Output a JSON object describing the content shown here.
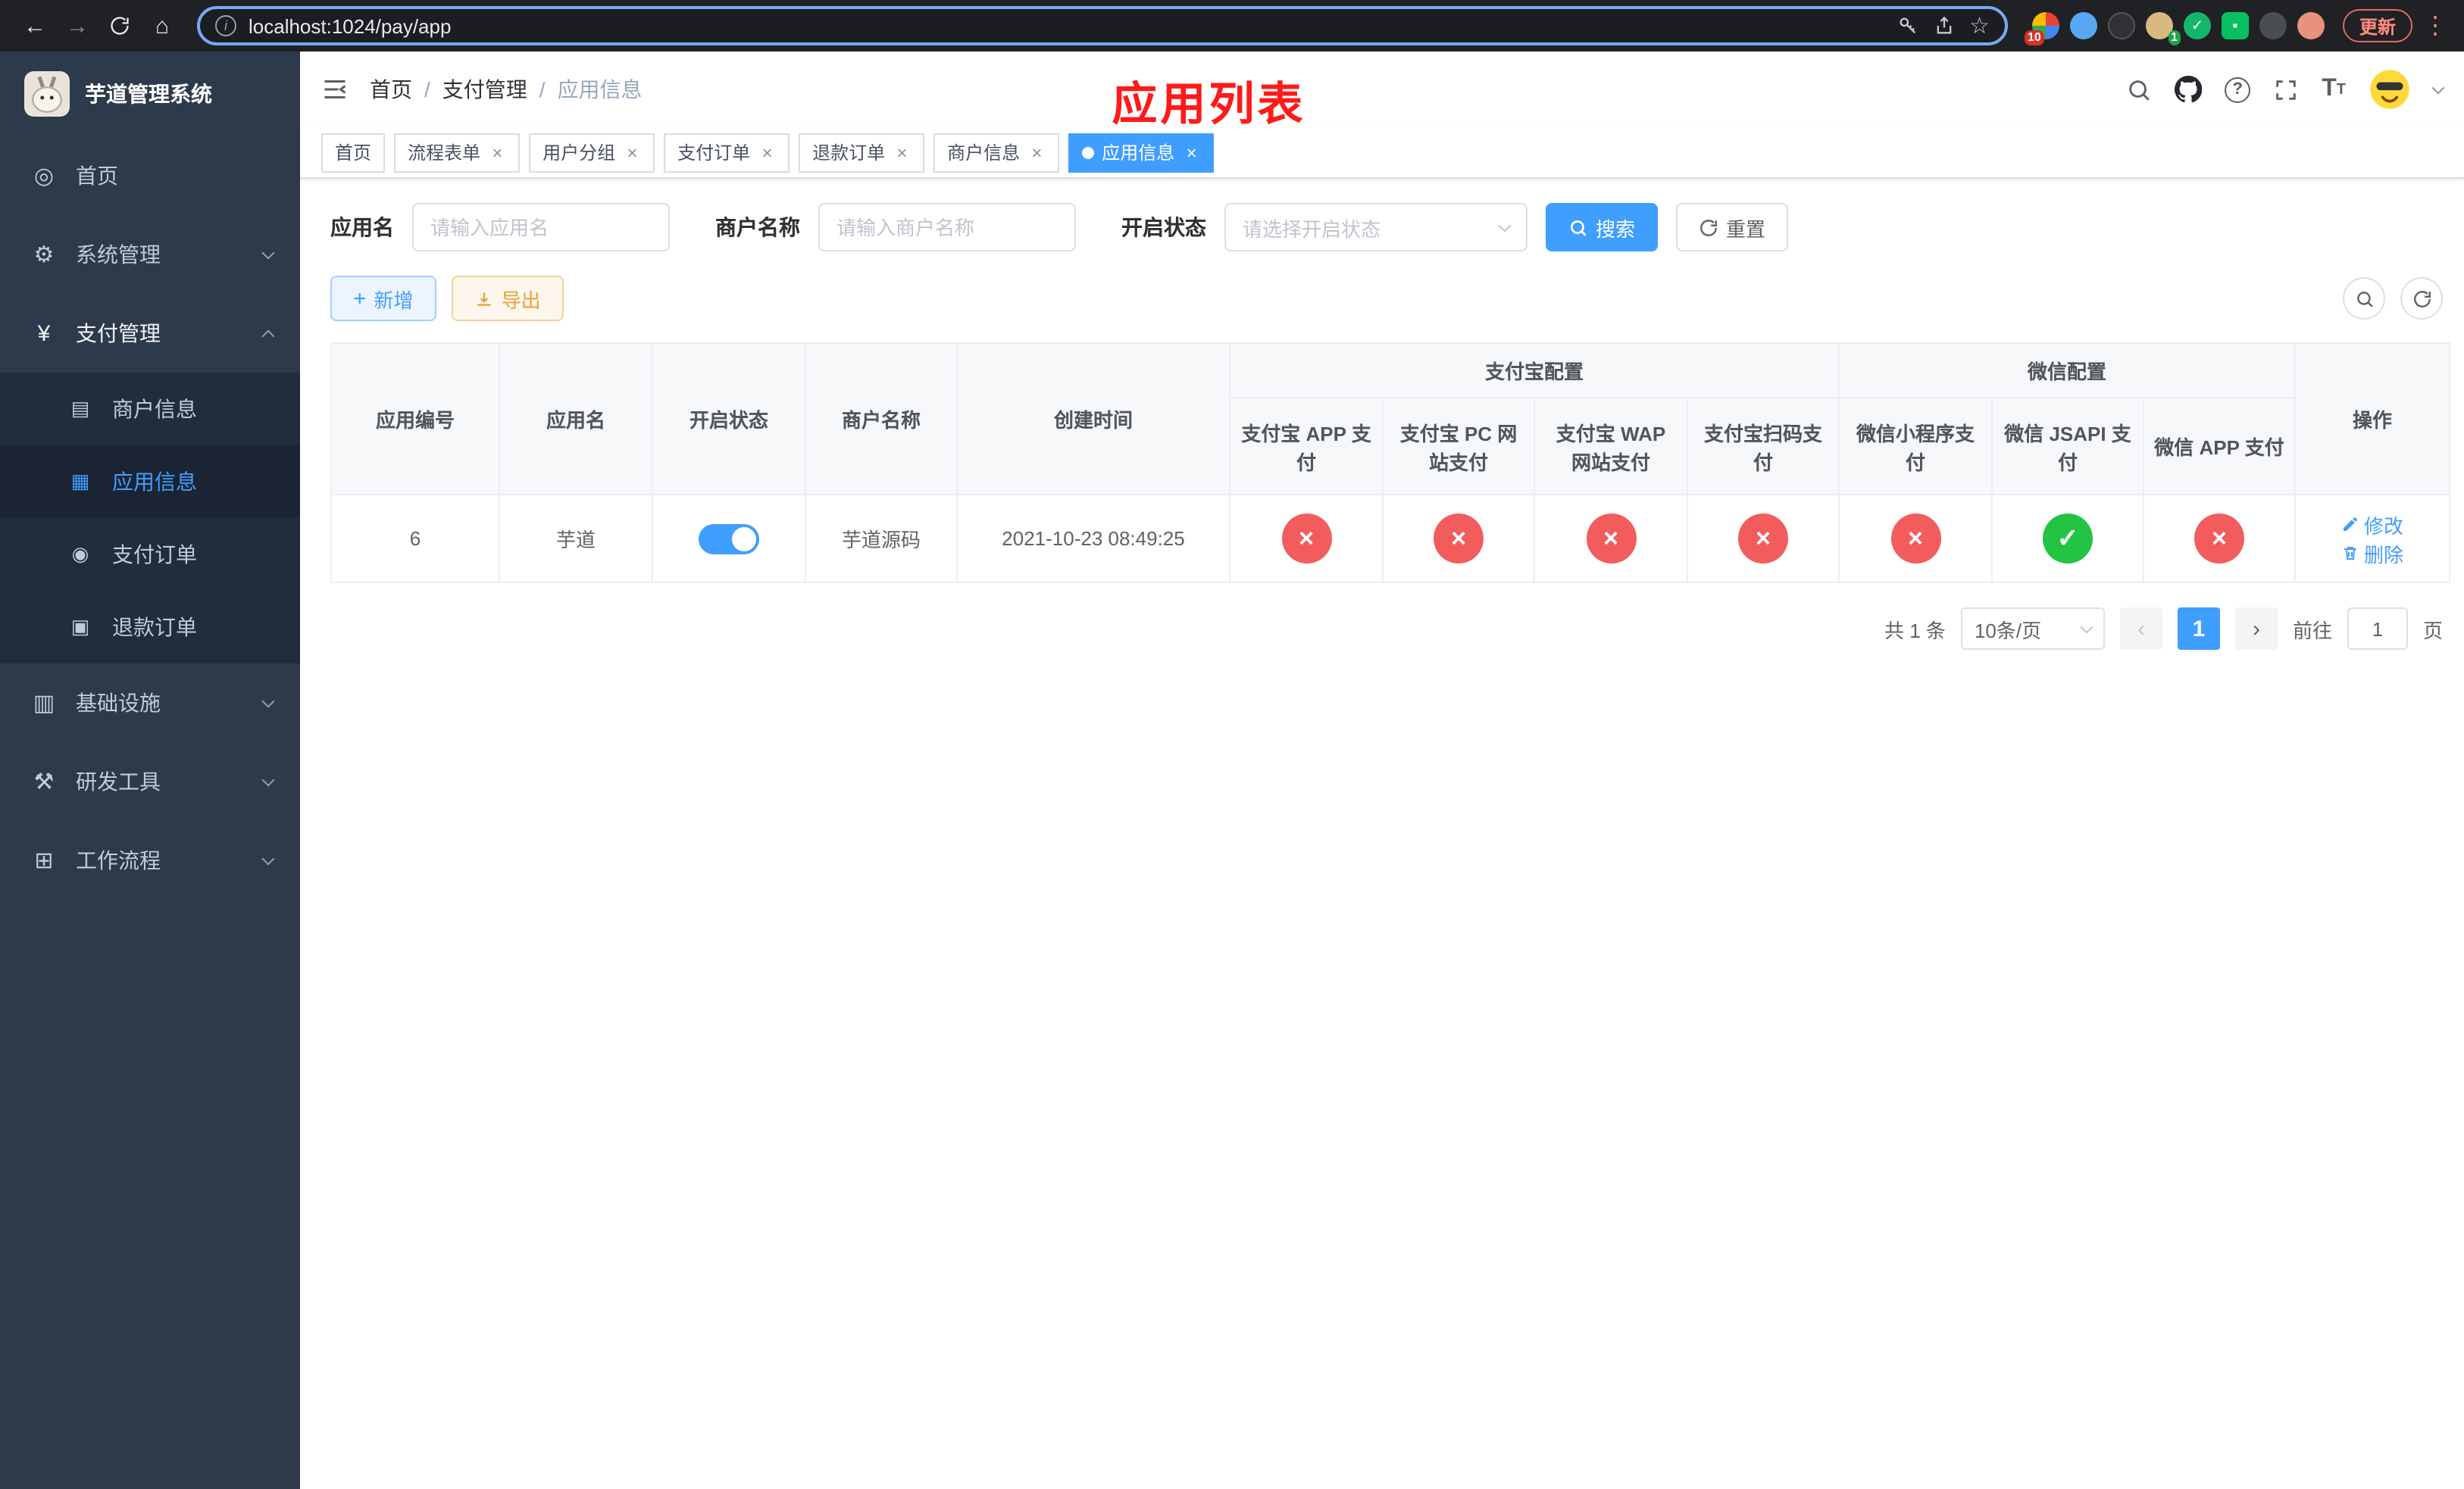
{
  "colors": {
    "accent": "#409eff",
    "danger": "#f25c5c",
    "success": "#23c343",
    "warning": "#e6a23c",
    "sidebar_bg": "#2d3a4b",
    "submenu_bg": "#1f2d3d"
  },
  "browser": {
    "url": "localhost:1024/pay/app",
    "update_label": "更新",
    "badges": {
      "extensions": "10",
      "profile": "1"
    }
  },
  "annotation": {
    "title": "应用列表"
  },
  "sidebar": {
    "title": "芋道管理系统",
    "items": [
      {
        "label": "首页",
        "icon": "dashboard-icon",
        "glyph": "◎"
      },
      {
        "label": "系统管理",
        "icon": "gear-icon",
        "glyph": "⚙"
      },
      {
        "label": "支付管理",
        "icon": "yen-icon",
        "glyph": "¥",
        "children": [
          {
            "label": "商户信息",
            "icon": "card-icon",
            "glyph": "▤"
          },
          {
            "label": "应用信息",
            "icon": "grid-icon",
            "glyph": "▦"
          },
          {
            "label": "支付订单",
            "icon": "coin-icon",
            "glyph": "◉"
          },
          {
            "label": "退款订单",
            "icon": "doc-icon",
            "glyph": "▣"
          }
        ]
      },
      {
        "label": "基础设施",
        "icon": "server-icon",
        "glyph": "▥"
      },
      {
        "label": "研发工具",
        "icon": "tools-icon",
        "glyph": "⚒"
      },
      {
        "label": "工作流程",
        "icon": "workflow-icon",
        "glyph": "⊞"
      }
    ]
  },
  "breadcrumb": {
    "items": [
      "首页",
      "支付管理",
      "应用信息"
    ],
    "separator": "/"
  },
  "tabs": [
    {
      "label": "首页"
    },
    {
      "label": "流程表单"
    },
    {
      "label": "用户分组"
    },
    {
      "label": "支付订单"
    },
    {
      "label": "退款订单"
    },
    {
      "label": "商户信息"
    },
    {
      "label": "应用信息"
    }
  ],
  "filters": {
    "app_name_label": "应用名",
    "app_name_placeholder": "请输入应用名",
    "merchant_label": "商户名称",
    "merchant_placeholder": "请输入商户名称",
    "status_label": "开启状态",
    "status_placeholder": "请选择开启状态",
    "search_label": "搜索",
    "reset_label": "重置"
  },
  "toolbar": {
    "add_label": "新增",
    "export_label": "导出"
  },
  "table": {
    "group_headers": {
      "alipay": "支付宝配置",
      "wechat": "微信配置"
    },
    "columns": {
      "app_id": "应用编号",
      "app_name": "应用名",
      "status": "开启状态",
      "merchant": "商户名称",
      "created": "创建时间",
      "alipay_app": "支付宝 APP 支付",
      "alipay_pc": "支付宝 PC 网站支付",
      "alipay_wap": "支付宝 WAP 网站支付",
      "alipay_qr": "支付宝扫码支付",
      "wx_mini": "微信小程序支付",
      "wx_jsapi": "微信 JSAPI 支付",
      "wx_app": "微信 APP 支付",
      "actions": "操作"
    },
    "rows": [
      {
        "app_id": "6",
        "app_name": "芋道",
        "enabled": true,
        "merchant": "芋道源码",
        "created": "2021-10-23 08:49:25",
        "configs": {
          "alipay_app": false,
          "alipay_pc": false,
          "alipay_wap": false,
          "alipay_qr": false,
          "wx_mini": false,
          "wx_jsapi": true,
          "wx_app": false
        },
        "actions": {
          "edit": "修改",
          "delete": "删除"
        }
      }
    ]
  },
  "pagination": {
    "total": "共 1 条",
    "page_size": "10条/页",
    "current_page": "1",
    "goto_label": "前往",
    "goto_value": "1",
    "unit_label": "页"
  }
}
